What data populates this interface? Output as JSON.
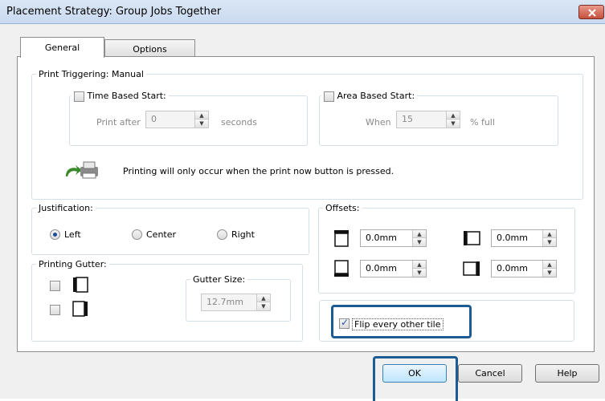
{
  "window": {
    "title": "Placement Strategy: Group Jobs Together"
  },
  "tabs": [
    {
      "label": "General"
    },
    {
      "label": "Options"
    }
  ],
  "print_triggering": {
    "legend": "Print Triggering: Manual",
    "time_based": {
      "label": "Time Based Start:",
      "checked": false,
      "prefix": "Print after",
      "value": "0",
      "unit": "seconds"
    },
    "area_based": {
      "label": "Area Based Start:",
      "checked": false,
      "prefix": "When",
      "value": "15",
      "unit": "% full"
    },
    "message": "Printing will only occur when the print now button is pressed."
  },
  "justification": {
    "legend": "Justification:",
    "options": [
      {
        "label": "Left",
        "selected": true
      },
      {
        "label": "Center",
        "selected": false
      },
      {
        "label": "Right",
        "selected": false
      }
    ]
  },
  "offsets": {
    "legend": "Offsets:",
    "top": "0.0mm",
    "left": "0.0mm",
    "bottom": "0.0mm",
    "right": "0.0mm"
  },
  "printing_gutter": {
    "legend": "Printing Gutter:",
    "gutter_size_legend": "Gutter Size:",
    "gutter_size_value": "12.7mm"
  },
  "flip": {
    "label": "Flip every other tile",
    "checked": true
  },
  "buttons": {
    "ok": "OK",
    "cancel": "Cancel",
    "help": "Help"
  },
  "colors": {
    "highlight": "#1e5b93",
    "title_bg": "#c9daf0",
    "close_bg": "#c7503d"
  }
}
